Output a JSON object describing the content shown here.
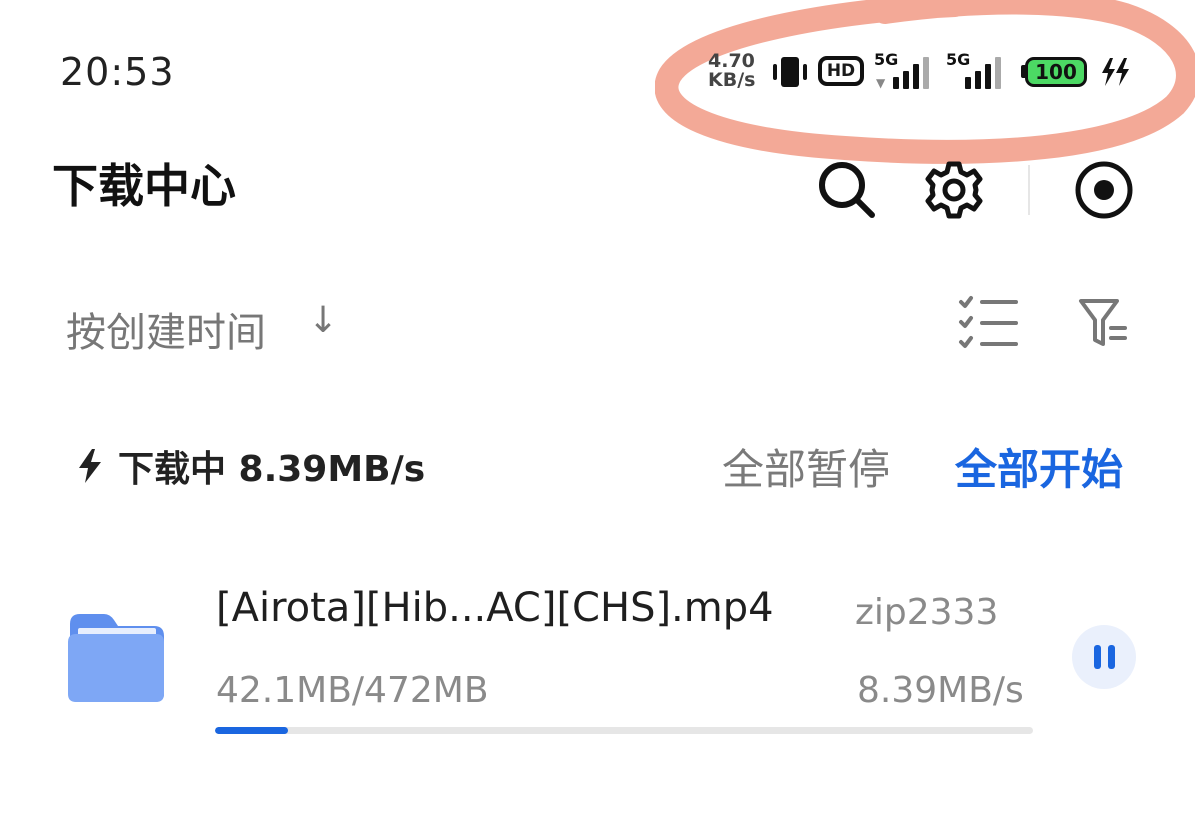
{
  "status_bar": {
    "time": "20:53",
    "net_speed_value": "4.70",
    "net_speed_unit": "KB/s",
    "hd_label": "HD",
    "sim1_label": "5G",
    "sim2_label": "5G",
    "battery_level": "100"
  },
  "header": {
    "title": "下载中心",
    "icons": [
      "search-icon",
      "gear-icon",
      "record-icon"
    ]
  },
  "sort": {
    "label": "按创建时间",
    "arrow": "↓",
    "icons": [
      "checklist-icon",
      "filter-icon"
    ]
  },
  "downloading": {
    "status": "下载中 8.39MB/s",
    "pause_all": "全部暂停",
    "start_all": "全部开始"
  },
  "downloads": [
    {
      "name": "[Airota][Hib...AC][CHS].mp4",
      "source": "zip2333",
      "progress_text": "42.1MB/472MB",
      "speed": "8.39MB/s",
      "progress_fraction": 0.089,
      "icon": "folder-icon"
    }
  ],
  "colors": {
    "accent": "#1a66e0",
    "battery": "#4cd964",
    "annotation": "#f2a08c",
    "folder": "#6f9cf3"
  }
}
